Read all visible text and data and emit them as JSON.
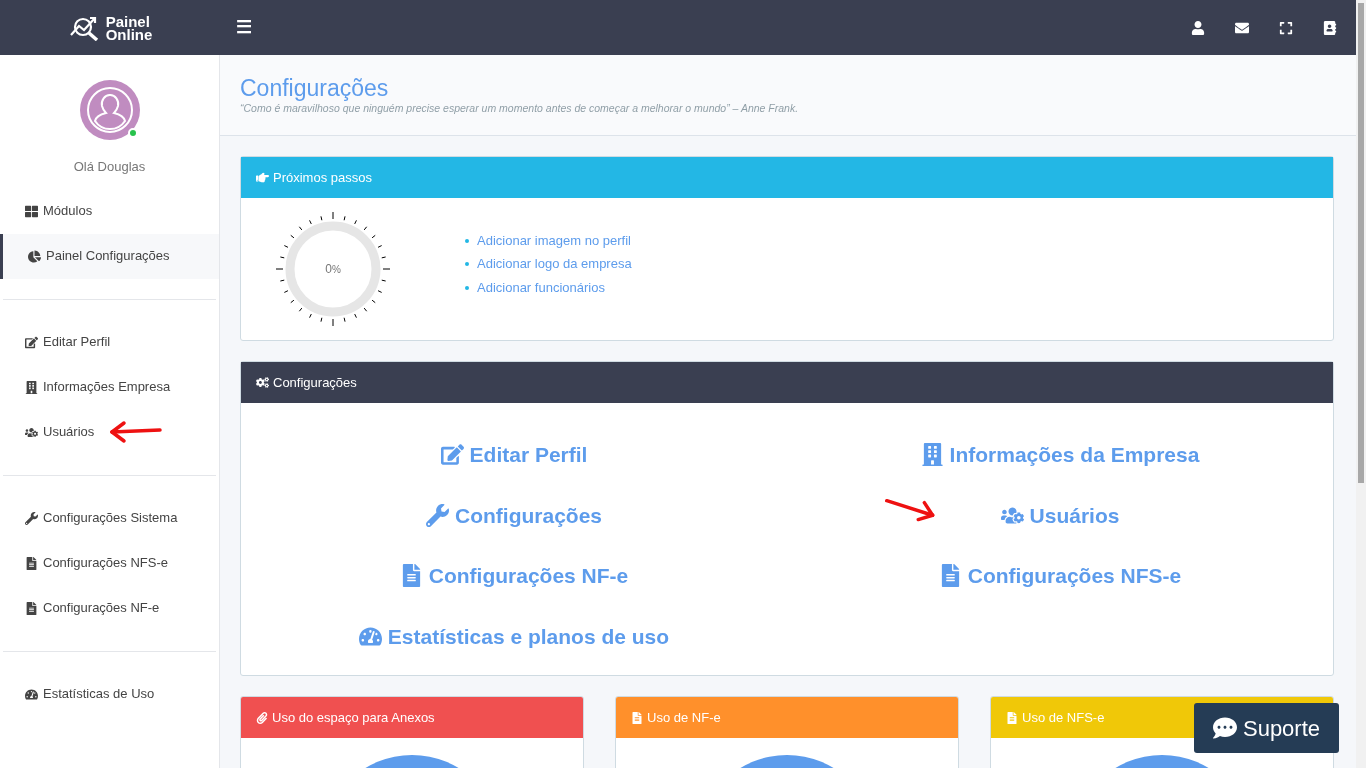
{
  "header": {
    "logo": [
      "Painel",
      "Online"
    ],
    "menu_icon": "☰"
  },
  "sidebar": {
    "greeting": "Olá Douglas",
    "online": true,
    "groups": [
      [
        {
          "label": "Módulos",
          "kind": "grid",
          "selected": false
        },
        {
          "label": "Painel Configurações",
          "kind": "pie",
          "selected": true
        }
      ],
      [
        {
          "label": "Editar Perfil",
          "kind": "edit",
          "selected": false
        },
        {
          "label": "Informações Empresa",
          "kind": "building",
          "selected": false
        },
        {
          "label": "Usuários",
          "kind": "users",
          "selected": false,
          "arrow": true
        }
      ],
      [
        {
          "label": "Configurações Sistema",
          "kind": "wrench",
          "selected": false
        },
        {
          "label": "Configurações NFS-e",
          "kind": "file",
          "selected": false
        },
        {
          "label": "Configurações NF-e",
          "kind": "file",
          "selected": false
        }
      ],
      [
        {
          "label": "Estatísticas de Uso",
          "kind": "gauge",
          "selected": false
        }
      ]
    ]
  },
  "page": {
    "title": "Configurações",
    "quote": "“Como é maravilhoso que ninguém precise esperar um momento antes de começar a melhorar o mundo” – Anne Frank."
  },
  "next_steps": {
    "title": "Próximos passos",
    "progress": {
      "value": "0",
      "unit": "%",
      "level": 0
    },
    "items": [
      "Adicionar imagem no perfil",
      "Adicionar logo da empresa",
      "Adicionar funcionários"
    ]
  },
  "settings": {
    "title": "Configurações",
    "links": [
      {
        "label": "Editar Perfil",
        "kind": "edit"
      },
      {
        "label": "Informações da Empresa",
        "kind": "building"
      },
      {
        "label": "Configurações",
        "kind": "wrench"
      },
      {
        "label": "Usuários",
        "kind": "users",
        "arrow": true
      },
      {
        "label": "Configurações NF-e",
        "kind": "file"
      },
      {
        "label": "Configurações NFS-e",
        "kind": "file"
      },
      {
        "label": "Estatísticas e planos de uso",
        "kind": "gauge"
      }
    ]
  },
  "usage_cards": [
    {
      "title": "Uso do espaço para Anexos",
      "kind": "clip",
      "color": "#f05050"
    },
    {
      "title": "Uso de NF-e",
      "kind": "file",
      "color": "#ff902b"
    },
    {
      "title": "Uso de NFS-e",
      "kind": "file",
      "color": "#f0c808"
    }
  ],
  "support_button": {
    "label": "Suporte"
  }
}
